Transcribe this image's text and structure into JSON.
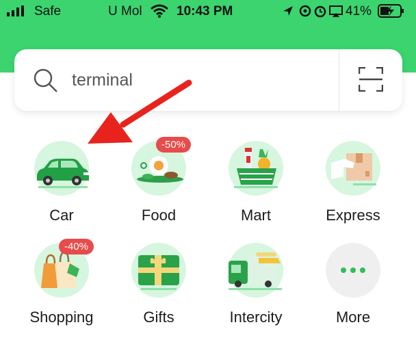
{
  "status_bar": {
    "carrier_1": "Safe",
    "carrier_2": "U Mol",
    "time": "10:43 PM",
    "battery": "41%"
  },
  "search": {
    "query": "terminal",
    "icons": {
      "search": "search-icon",
      "scan": "scan-icon"
    }
  },
  "services": [
    {
      "label": "Car",
      "icon": "car-icon"
    },
    {
      "label": "Food",
      "icon": "food-icon",
      "badge": "-50%"
    },
    {
      "label": "Mart",
      "icon": "mart-icon"
    },
    {
      "label": "Express",
      "icon": "express-icon"
    },
    {
      "label": "Shopping",
      "icon": "shopping-icon",
      "badge": "-40%"
    },
    {
      "label": "Gifts",
      "icon": "gift-icon"
    },
    {
      "label": "Intercity",
      "icon": "intercity-icon"
    },
    {
      "label": "More",
      "icon": "more-icon"
    }
  ],
  "annotation": {
    "arrow": "red-arrow-icon",
    "arrow_color": "#e8231e"
  },
  "colors": {
    "brand_green": "#3bd46f",
    "icon_bg": "#d6f6df",
    "badge_red": "#e84b4b"
  }
}
